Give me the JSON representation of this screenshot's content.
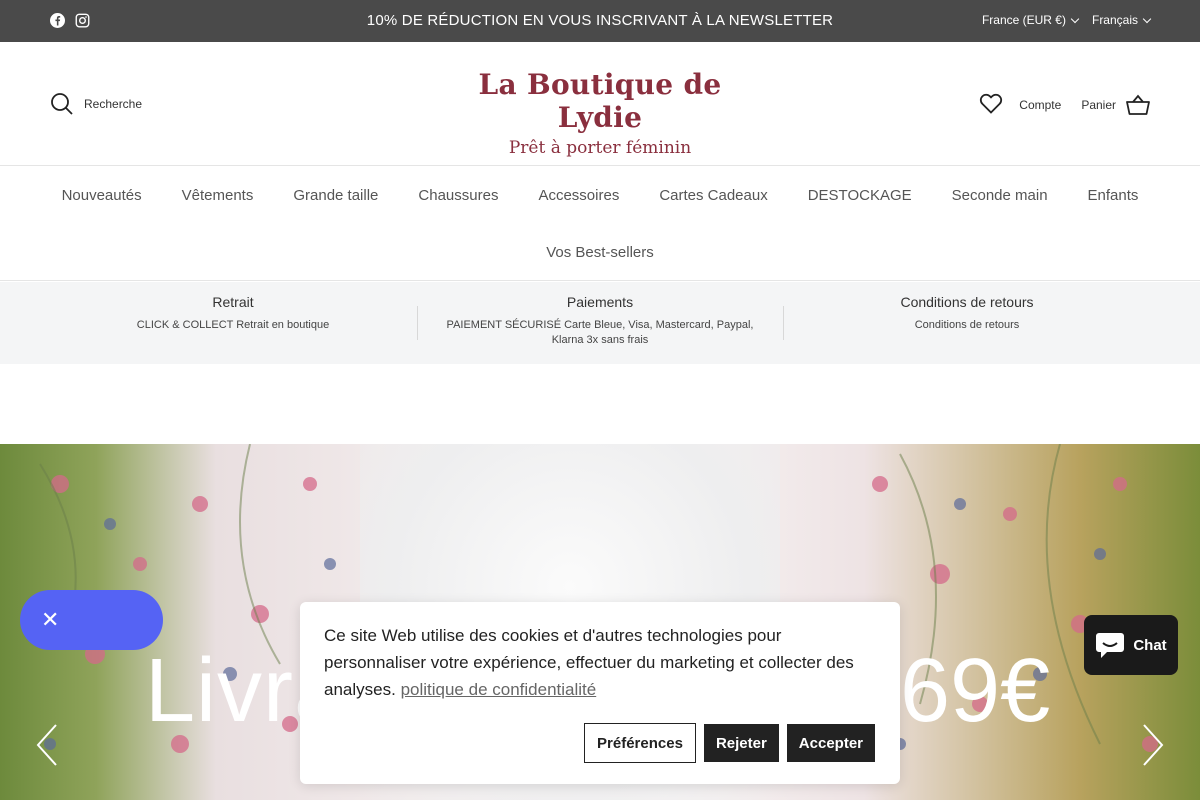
{
  "topbar": {
    "promo": "10% DE RÉDUCTION EN VOUS INSCRIVANT À LA NEWSLETTER",
    "country": "France (EUR €)",
    "language": "Français"
  },
  "header": {
    "search_label": "Recherche",
    "logo_line1": "La Boutique de Lydie",
    "logo_line2": "Prêt à porter féminin",
    "account_label": "Compte",
    "cart_label": "Panier",
    "brand_color": "#8a2f3e"
  },
  "nav": {
    "items": [
      "Nouveautés",
      "Vêtements",
      "Grande taille",
      "Chaussures",
      "Accessoires",
      "Cartes Cadeaux",
      "DESTOCKAGE",
      "Seconde main",
      "Enfants"
    ],
    "row2": "Vos Best-sellers"
  },
  "strip": {
    "cols": [
      {
        "title": "Retrait",
        "desc": "CLICK & COLLECT Retrait en boutique"
      },
      {
        "title": "Paiements",
        "desc": "PAIEMENT SÉCURISÉ Carte Bleue, Visa, Mastercard, Paypal, Klarna 3x sans frais"
      },
      {
        "title": "Conditions de retours",
        "desc": "Conditions de retours"
      }
    ]
  },
  "hero": {
    "headline_left": "Livra",
    "headline_right": "69€"
  },
  "cookie": {
    "message": "Ce site Web utilise des cookies et d'autres technologies pour personnaliser votre expérience, effectuer du marketing et collecter des analyses.",
    "link": "politique de confidentialité",
    "prefs": "Préférences",
    "reject": "Rejeter",
    "accept": "Accepter"
  },
  "chat": {
    "label": "Chat"
  },
  "colors": {
    "accent_pill": "#5563f4",
    "topbar": "#4a4a4a"
  }
}
